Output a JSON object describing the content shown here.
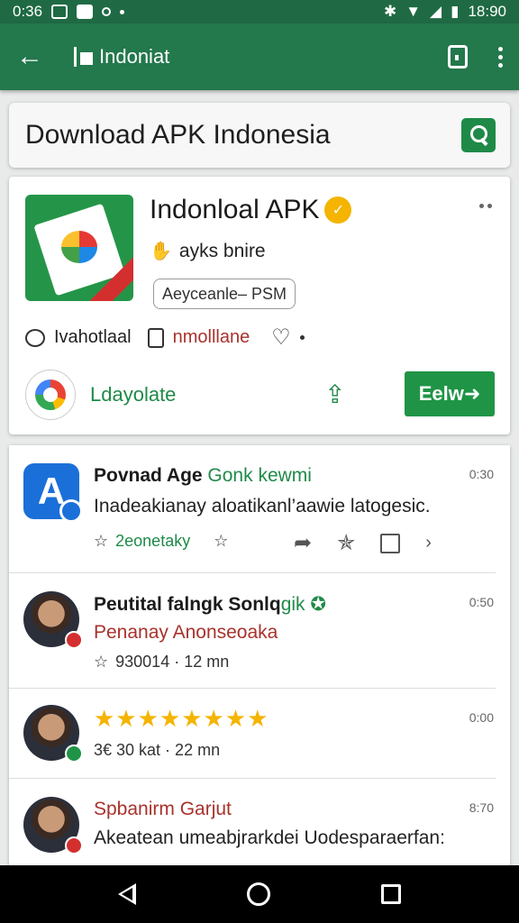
{
  "status": {
    "time": "0:36",
    "clock": "18:90"
  },
  "appbar": {
    "title": "Indoniat"
  },
  "search": {
    "query": "Download APK Indonesia"
  },
  "app": {
    "name": "Indonloal APK",
    "developer": "ayks bnire",
    "chip": "Aeyceanle– PSM",
    "meta_left": "Ivahotlaal",
    "meta_right": "nmolllane",
    "update_label": "Ldayolate",
    "new_button": "Eelw➜"
  },
  "items": [
    {
      "title": "Povnad Age",
      "title_green": "Gonk kewmi",
      "subtitle": "Inadeakianay aloatikanl’aawie latogesic.",
      "meta": "2eonetaky",
      "time": "0:30"
    },
    {
      "title": "Peutital falngk Sonlq",
      "title_green": "gik",
      "subtitle": "Penanay Anonseoaka",
      "meta": "930014 · 12 mn",
      "time": "0:50"
    },
    {
      "stars": "★★★★★★★★",
      "meta": "3€ 30 kat · 22 mn",
      "time": "0:00"
    },
    {
      "title": "Spbanirm Garjut",
      "subtitle": "Akeatean umeabjrarkdei Uodesparaerfan:",
      "time": "8:70"
    }
  ],
  "icons": {
    "back": "arrow-left-icon",
    "search": "search-icon",
    "share": "share-icon",
    "star": "star-outline-icon",
    "heart": "heart-outline-icon"
  },
  "colors": {
    "appbar": "#23784c",
    "accent_green": "#1f9446",
    "star_yellow": "#f4b400",
    "red_text": "#a8322c"
  }
}
